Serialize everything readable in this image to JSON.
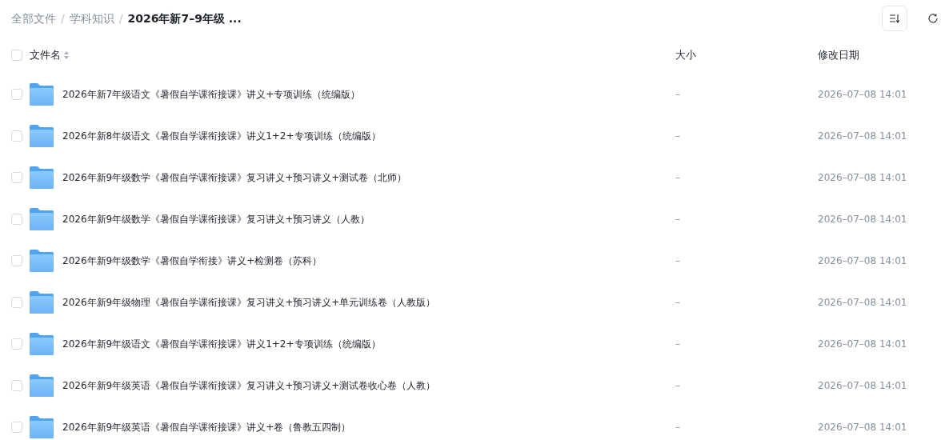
{
  "breadcrumb": [
    {
      "label": "全部文件",
      "current": false
    },
    {
      "label": "学科知识",
      "current": false
    },
    {
      "label": "2026年新7–9年级 ...",
      "current": true
    }
  ],
  "breadcrumb_separator": "/",
  "table": {
    "select_all": {
      "checked": false
    },
    "columns": [
      {
        "label": "文件名",
        "sortable": true
      },
      {
        "label": "大小"
      },
      {
        "label": "修改日期"
      }
    ],
    "rows": [
      {
        "checked": false,
        "name": "2026年新7年级语文《暑假自学课衔接课》讲义+专项训练（统编版）",
        "size": "–",
        "modified": "2026–07–08 14:01"
      },
      {
        "checked": false,
        "name": "2026年新8年级语文《暑假自学课衔接课》讲义1+2+专项训练（统编版）",
        "size": "–",
        "modified": "2026–07–08 14:01"
      },
      {
        "checked": false,
        "name": "2026年新9年级数学《暑假自学课衔接课》复习讲义+预习讲义+测试卷（北师）",
        "size": "–",
        "modified": "2026–07–08 14:01"
      },
      {
        "checked": false,
        "name": "2026年新9年级数学《暑假自学课衔接课》复习讲义+预习讲义（人教）",
        "size": "–",
        "modified": "2026–07–08 14:01"
      },
      {
        "checked": false,
        "name": "2026年新9年级数学《暑假自学衔接》讲义+检测卷（苏科）",
        "size": "–",
        "modified": "2026–07–08 14:01"
      },
      {
        "checked": false,
        "name": "2026年新9年级物理《暑假自学课衔接课》复习讲义+预习讲义+单元训练卷（人教版）",
        "size": "–",
        "modified": "2026–07–08 14:01"
      },
      {
        "checked": false,
        "name": "2026年新9年级语文《暑假自学课衔接课》讲义1+2+专项训练（统编版）",
        "size": "–",
        "modified": "2026–07–08 14:01"
      },
      {
        "checked": false,
        "name": "2026年新9年级英语《暑假自学课衔接课》复习讲义+预习讲义+测试卷收心卷（人教）",
        "size": "–",
        "modified": "2026–07–08 14:01"
      },
      {
        "checked": false,
        "name": "2026年新9年级英语《暑假自学课衔接课》讲义+卷（鲁教五四制）",
        "size": "–",
        "modified": "2026–07–08 14:01"
      }
    ]
  }
}
